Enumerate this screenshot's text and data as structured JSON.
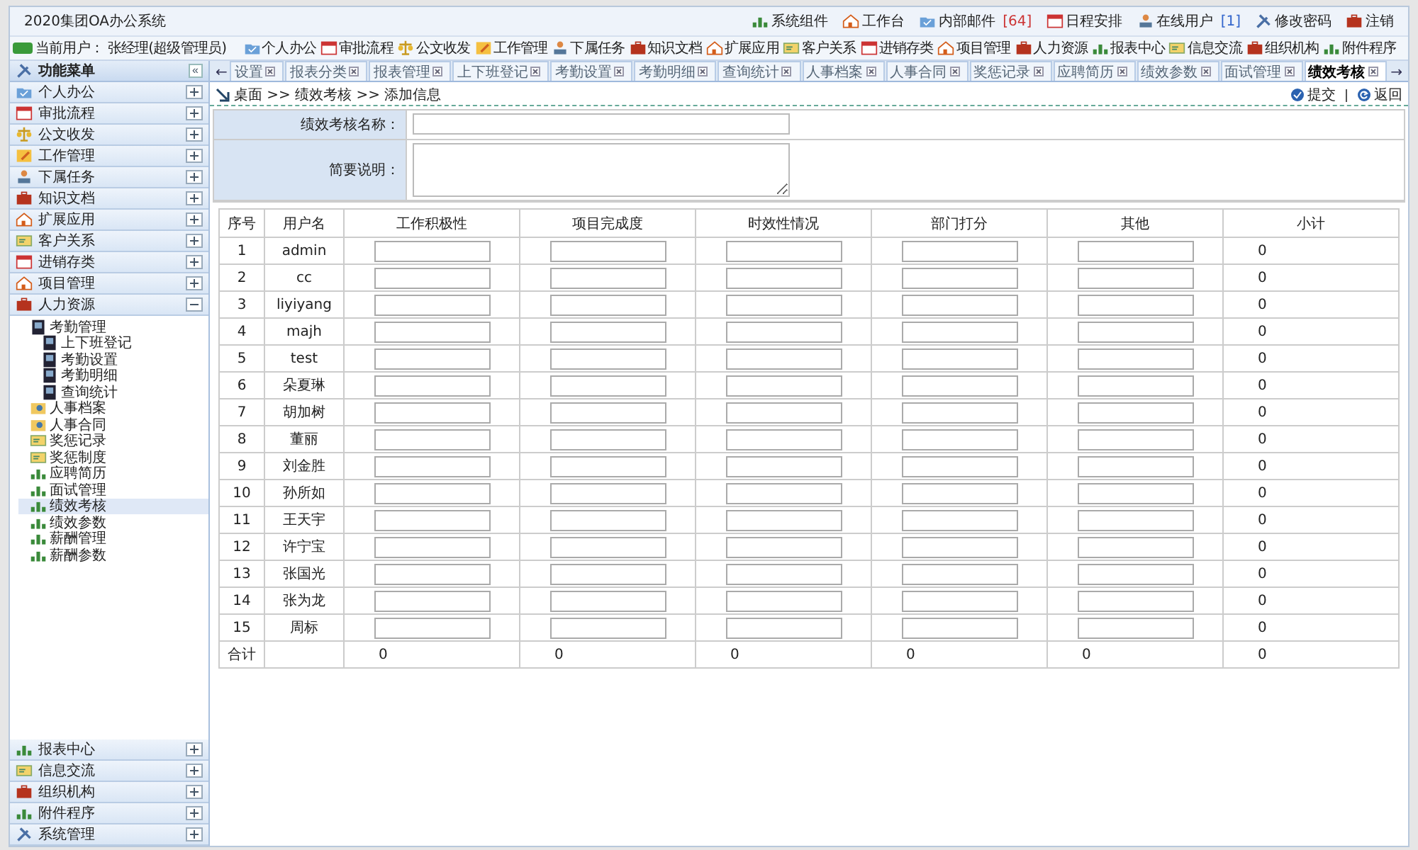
{
  "window": {
    "title": "2020集团OA办公系统"
  },
  "top_links": [
    {
      "label": "系统组件"
    },
    {
      "label": "工作台"
    },
    {
      "label": "内部邮件",
      "count": "[64]"
    },
    {
      "label": "日程安排"
    },
    {
      "label": "在线用户",
      "count": "[1]"
    },
    {
      "label": "修改密码"
    },
    {
      "label": "注销"
    }
  ],
  "current_user": "当前用户：  张经理(超级管理员)",
  "toolbar": [
    "个人办公",
    "审批流程",
    "公文收发",
    "工作管理",
    "下属任务",
    "知识文档",
    "扩展应用",
    "客户关系",
    "进销存类",
    "项目管理",
    "人力资源",
    "报表中心",
    "信息交流",
    "组织机构",
    "附件程序"
  ],
  "sidebar": {
    "title": "功能菜单",
    "collapse": "«",
    "items": [
      {
        "label": "个人办公",
        "expanded": false
      },
      {
        "label": "审批流程",
        "expanded": false
      },
      {
        "label": "公文收发",
        "expanded": false
      },
      {
        "label": "工作管理",
        "expanded": false
      },
      {
        "label": "下属任务",
        "expanded": false
      },
      {
        "label": "知识文档",
        "expanded": false
      },
      {
        "label": "扩展应用",
        "expanded": false
      },
      {
        "label": "客户关系",
        "expanded": false
      },
      {
        "label": "进销存类",
        "expanded": false
      },
      {
        "label": "项目管理",
        "expanded": false
      },
      {
        "label": "人力资源",
        "expanded": true
      }
    ],
    "tree": [
      {
        "label": "考勤管理",
        "selected": false,
        "expanded": true,
        "children": [
          {
            "label": "上下班登记",
            "selected": false
          },
          {
            "label": "考勤设置",
            "selected": false
          },
          {
            "label": "考勤明细",
            "selected": false
          },
          {
            "label": "查询统计",
            "selected": false
          }
        ]
      },
      {
        "label": "人事档案",
        "selected": false
      },
      {
        "label": "人事合同",
        "selected": false
      },
      {
        "label": "奖惩记录",
        "selected": false
      },
      {
        "label": "奖惩制度",
        "selected": false
      },
      {
        "label": "应聘简历",
        "selected": false
      },
      {
        "label": "面试管理",
        "selected": false
      },
      {
        "label": "绩效考核",
        "selected": true
      },
      {
        "label": "绩效参数",
        "selected": false
      },
      {
        "label": "薪酬管理",
        "selected": false
      },
      {
        "label": "薪酬参数",
        "selected": false
      }
    ],
    "bottom_items": [
      {
        "label": "报表中心",
        "expanded": false
      },
      {
        "label": "信息交流",
        "expanded": false
      },
      {
        "label": "组织机构",
        "expanded": false
      },
      {
        "label": "附件程序",
        "expanded": false
      },
      {
        "label": "系统管理",
        "expanded": false
      }
    ]
  },
  "tabs": {
    "prev": "←",
    "next": "→",
    "items": [
      {
        "label": "设置",
        "selected": false
      },
      {
        "label": "报表分类",
        "selected": false
      },
      {
        "label": "报表管理",
        "selected": false
      },
      {
        "label": "上下班登记",
        "selected": false
      },
      {
        "label": "考勤设置",
        "selected": false
      },
      {
        "label": "考勤明细",
        "selected": false
      },
      {
        "label": "查询统计",
        "selected": false
      },
      {
        "label": "人事档案",
        "selected": false
      },
      {
        "label": "人事合同",
        "selected": false
      },
      {
        "label": "奖惩记录",
        "selected": false
      },
      {
        "label": "应聘简历",
        "selected": false
      },
      {
        "label": "绩效参数",
        "selected": false
      },
      {
        "label": "面试管理",
        "selected": false
      },
      {
        "label": "绩效考核",
        "selected": true
      }
    ]
  },
  "breadcrumb": "桌面 >> 绩效考核 >> 添加信息",
  "actions": [
    "提交",
    "返回"
  ],
  "form": [
    {
      "label": "绩效考核名称：",
      "kind": "input"
    },
    {
      "label": "简要说明：",
      "kind": "textarea"
    }
  ],
  "table": {
    "columns": [
      "序号",
      "用户名",
      "工作积极性",
      "项目完成度",
      "时效性情况",
      "部门打分",
      "其他",
      "小计"
    ],
    "rows": [
      {
        "no": "1",
        "user": "admin",
        "subtotal": "0"
      },
      {
        "no": "2",
        "user": "cc",
        "subtotal": "0"
      },
      {
        "no": "3",
        "user": "liyiyang",
        "subtotal": "0"
      },
      {
        "no": "4",
        "user": "majh",
        "subtotal": "0"
      },
      {
        "no": "5",
        "user": "test",
        "subtotal": "0"
      },
      {
        "no": "6",
        "user": "朵夏琳",
        "subtotal": "0"
      },
      {
        "no": "7",
        "user": "胡加树",
        "subtotal": "0"
      },
      {
        "no": "8",
        "user": "董丽",
        "subtotal": "0"
      },
      {
        "no": "9",
        "user": "刘金胜",
        "subtotal": "0"
      },
      {
        "no": "10",
        "user": "孙所如",
        "subtotal": "0"
      },
      {
        "no": "11",
        "user": "王天宇",
        "subtotal": "0"
      },
      {
        "no": "12",
        "user": "许宁宝",
        "subtotal": "0"
      },
      {
        "no": "13",
        "user": "张国光",
        "subtotal": "0"
      },
      {
        "no": "14",
        "user": "张为龙",
        "subtotal": "0"
      },
      {
        "no": "15",
        "user": "周标",
        "subtotal": "0"
      }
    ],
    "total": {
      "label": "合计",
      "values": [
        "0",
        "0",
        "0",
        "0",
        "0",
        "0"
      ]
    }
  }
}
